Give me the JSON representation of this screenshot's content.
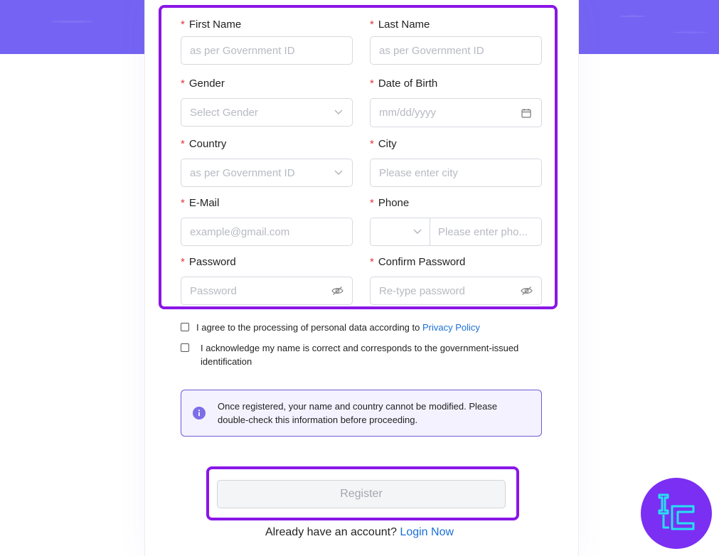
{
  "form": {
    "first_name": {
      "label": "First Name",
      "placeholder": "as per Government ID"
    },
    "last_name": {
      "label": "Last Name",
      "placeholder": "as per Government ID"
    },
    "gender": {
      "label": "Gender",
      "placeholder": "Select Gender"
    },
    "dob": {
      "label": "Date of Birth",
      "placeholder": "mm/dd/yyyy"
    },
    "country": {
      "label": "Country",
      "placeholder": "as per Government ID"
    },
    "city": {
      "label": "City",
      "placeholder": "Please enter city"
    },
    "email": {
      "label": "E-Mail",
      "placeholder": "example@gmail.com"
    },
    "phone": {
      "label": "Phone",
      "placeholder": "Please enter pho..."
    },
    "password": {
      "label": "Password",
      "placeholder": "Password"
    },
    "confirm_password": {
      "label": "Confirm Password",
      "placeholder": "Re-type password"
    },
    "required_mark": "*"
  },
  "consent": {
    "privacy_text": "I agree to the processing of personal data according to",
    "privacy_link": "Privacy Policy",
    "name_ack_text": "I acknowledge my name is correct and corresponds to the government-issued identification"
  },
  "notice": {
    "text": "Once registered, your name and country cannot be modified. Please double-check this information before proceeding.",
    "icon": "info-icon"
  },
  "register": {
    "label": "Register"
  },
  "login": {
    "prompt": "Already have an account?",
    "link": "Login Now"
  },
  "colors": {
    "accent": "#8a16e6",
    "band": "#7564f3",
    "required": "#e0373b",
    "link": "#1a6fd6",
    "logo_bg": "#7b2ff3",
    "logo_mark": "#26e0f0"
  }
}
